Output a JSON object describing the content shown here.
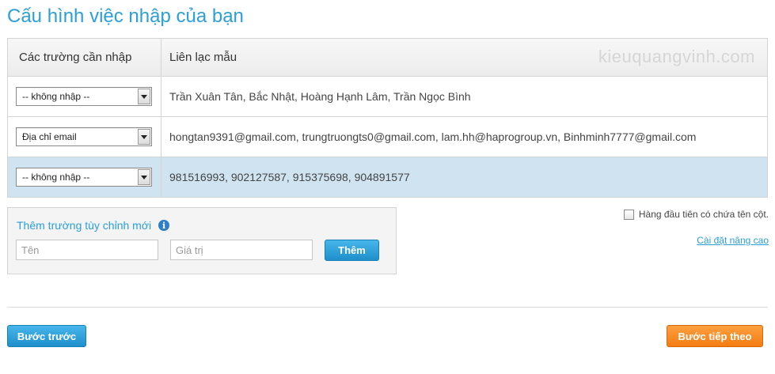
{
  "page": {
    "title": "Cấu hình việc nhập của bạn"
  },
  "table": {
    "headers": {
      "fields": "Các trường cần nhập",
      "sample": "Liên lạc mẫu"
    },
    "watermark": "kieuquangvinh.com",
    "rows": [
      {
        "field": "-- không nhập --",
        "sample": "Trần Xuân Tân, Bắc Nhật, Hoàng Hạnh Lâm, Trần Ngọc Bình"
      },
      {
        "field": "Địa chỉ email",
        "sample": "hongtan9391@gmail.com, trungtruongts0@gmail.com, lam.hh@haprogroup.vn, Binhminh7777@gmail.com"
      },
      {
        "field": "-- không nhập --",
        "sample": "981516993, 902127587, 915375698, 904891577"
      }
    ]
  },
  "custom_field": {
    "title": "Thêm trường tùy chỉnh mới",
    "name_placeholder": "Tên",
    "value_placeholder": "Giá trị",
    "add_label": "Thêm"
  },
  "options": {
    "header_row_label": "Hàng đầu tiên có chứa tên cột.",
    "header_row_checked": false,
    "advanced_link": "Cài đặt nâng cao"
  },
  "nav": {
    "prev_label": "Bước trước",
    "next_label": "Bước tiếp theo"
  },
  "colors": {
    "accent": "#2a9fd8",
    "selected_row": "#cfe3f0",
    "next_button": "#f47c12"
  }
}
